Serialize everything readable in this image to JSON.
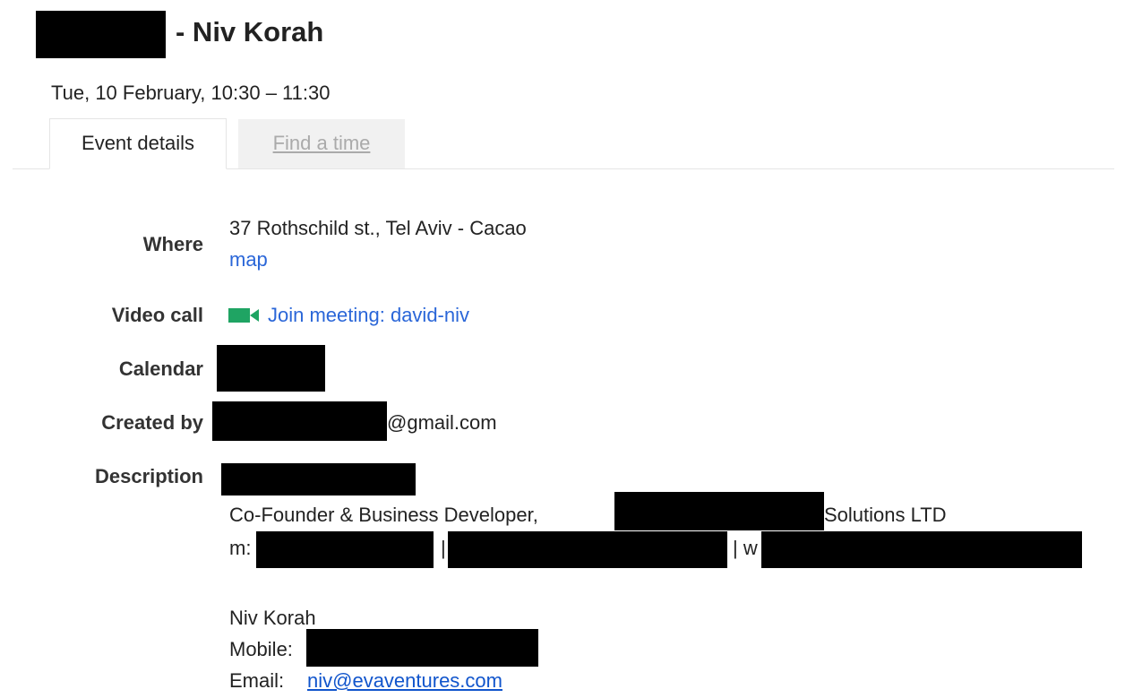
{
  "event": {
    "title": "- Niv Korah",
    "datetime": "Tue, 10 February, 10:30 – 11:30"
  },
  "tabs": [
    {
      "label": "Event details",
      "active": true
    },
    {
      "label": "Find a time",
      "active": false
    }
  ],
  "details": {
    "where": {
      "label": "Where",
      "value": "37 Rothschild st., Tel Aviv - Cacao",
      "map_link": "map"
    },
    "video_call": {
      "label": "Video call",
      "link": "Join meeting: david-niv",
      "icon": "video-camera-icon"
    },
    "calendar": {
      "label": "Calendar"
    },
    "created_by": {
      "label": "Created by",
      "suffix": "@gmail.com"
    },
    "description": {
      "label": "Description",
      "line1_prefix": "Co-Founder & Business Developer,",
      "line1_suffix": "Solutions LTD",
      "line2_m": "m:",
      "line2_sep1": "|",
      "line2_sep2": "| w",
      "name": "Niv Korah",
      "mobile_label": "Mobile:",
      "email_label": "Email:",
      "email_link": "niv@evaventures.com"
    }
  },
  "colors": {
    "link": "#2a66d8",
    "video_icon": "#1fa463",
    "redaction": "#000000"
  }
}
